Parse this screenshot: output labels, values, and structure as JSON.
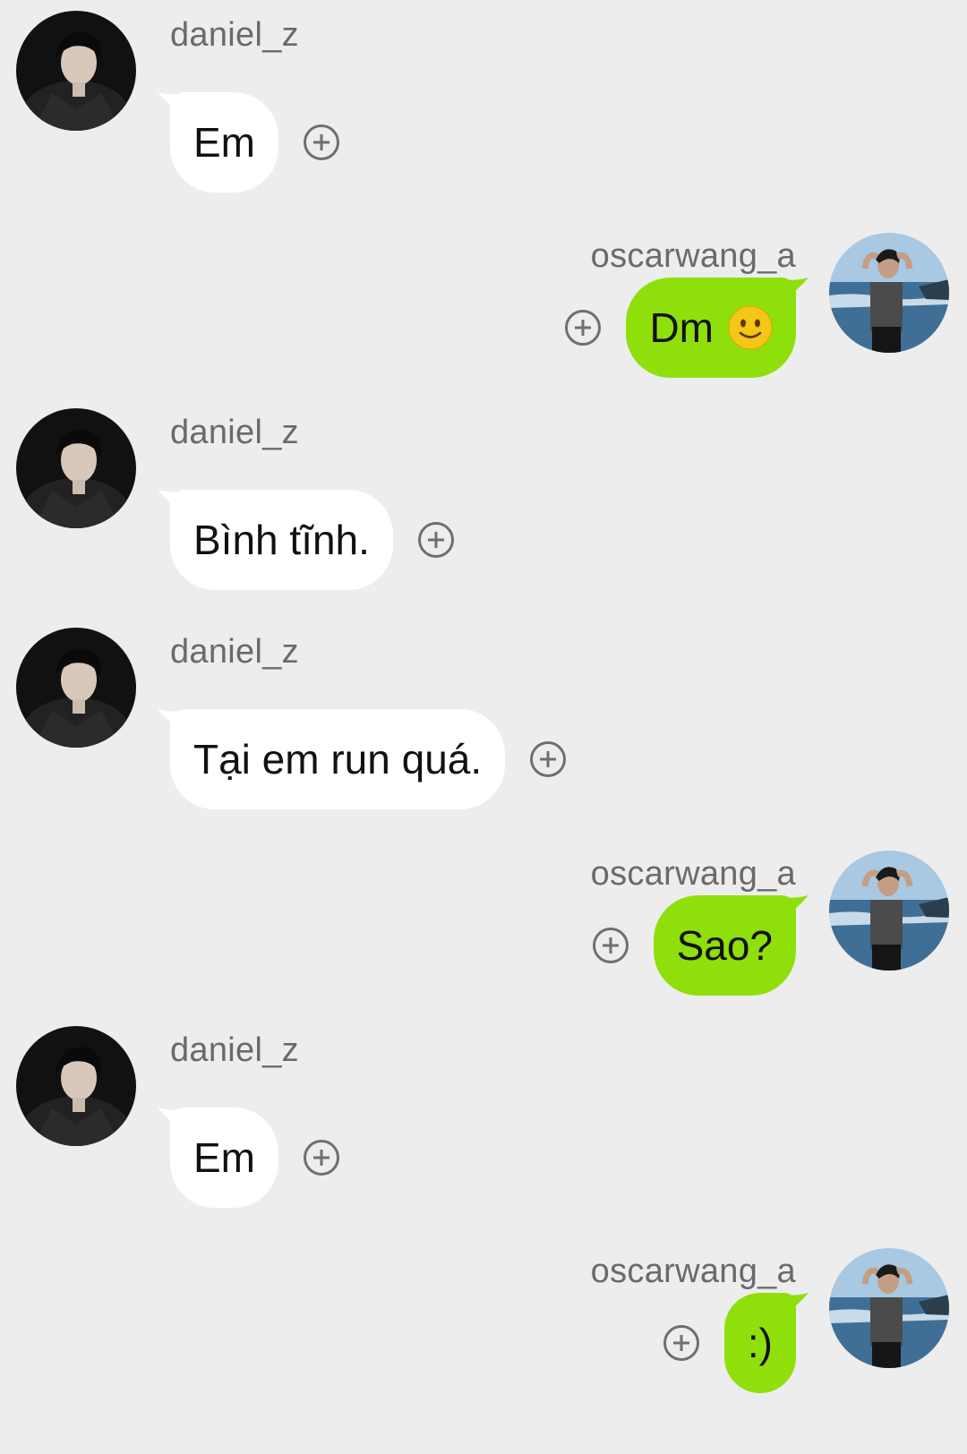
{
  "colors": {
    "background": "#ededed",
    "incoming_bubble": "#ffffff",
    "outgoing_bubble": "#8fe00b",
    "sender_text": "#6a6a6a"
  },
  "messages": [
    {
      "sender": "daniel_z",
      "direction": "incoming",
      "text": "Em",
      "add_icon": "plus-circle-icon"
    },
    {
      "sender": "oscarwang_a",
      "direction": "outgoing",
      "text": "Dm",
      "emoji": "slightly-smiling-face",
      "add_icon": "plus-circle-icon"
    },
    {
      "sender": "daniel_z",
      "direction": "incoming",
      "text": "Bình tĩnh.",
      "add_icon": "plus-circle-icon"
    },
    {
      "sender": "daniel_z",
      "direction": "incoming",
      "text": "Tại em run quá.",
      "add_icon": "plus-circle-icon"
    },
    {
      "sender": "oscarwang_a",
      "direction": "outgoing",
      "text": "Sao?",
      "add_icon": "plus-circle-icon"
    },
    {
      "sender": "daniel_z",
      "direction": "incoming",
      "text": "Em",
      "add_icon": "plus-circle-icon"
    },
    {
      "sender": "oscarwang_a",
      "direction": "outgoing",
      "text": ":)",
      "add_icon": "plus-circle-icon"
    }
  ]
}
